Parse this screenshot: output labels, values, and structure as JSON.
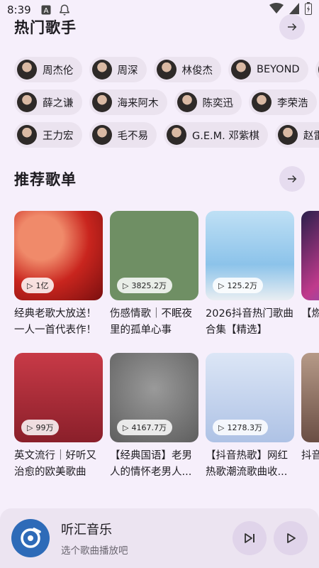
{
  "status_bar": {
    "time": "8:39"
  },
  "sections": {
    "singers": {
      "title": "热门歌手"
    },
    "playlists": {
      "title": "推荐歌单"
    }
  },
  "singers": {
    "rows": [
      [
        "周杰伦",
        "周深",
        "林俊杰",
        "BEYOND"
      ],
      [
        "薛之谦",
        "海来阿木",
        "陈奕迅",
        "李荣浩"
      ],
      [
        "王力宏",
        "毛不易",
        "G.E.M. 邓紫棋",
        "赵雷"
      ]
    ]
  },
  "playlists": {
    "rows": [
      [
        {
          "count": "1亿",
          "title": "经典老歌大放送！一人一首代表作！"
        },
        {
          "count": "3825.2万",
          "title": "伤感情歌｜不眠夜里的孤单心事"
        },
        {
          "count": "125.2万",
          "title": "2026抖音热门歌曲合集【精选】"
        },
        {
          "count": "",
          "title": "【燃房伪"
        }
      ],
      [
        {
          "count": "99万",
          "title": "英文流行｜好听又治愈的欧美歌曲"
        },
        {
          "count": "4167.7万",
          "title": "【经典国语】老男人的情怀老男人..."
        },
        {
          "count": "1278.3万",
          "title": "【抖音热歌】网红热歌潮流歌曲收..."
        },
        {
          "count": "",
          "title": "抖音曲陷"
        }
      ]
    ]
  },
  "player": {
    "title": "听汇音乐",
    "subtitle": "选个歌曲播放吧"
  }
}
